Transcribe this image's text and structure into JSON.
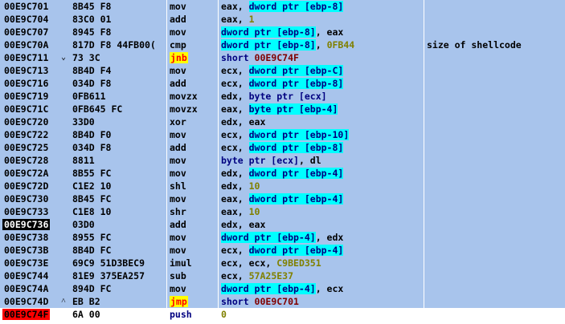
{
  "rows": [
    {
      "addr": "00E9C701",
      "arrow": "",
      "hex": "8B45 F8",
      "mnem": "mov",
      "mnem_style": "plain",
      "ops": [
        {
          "t": "eax, ",
          "k": "reg"
        },
        {
          "t": "dword ptr [ebp-8]",
          "k": "mem"
        }
      ],
      "comment": ""
    },
    {
      "addr": "00E9C704",
      "arrow": "",
      "hex": "83C0 01",
      "mnem": "add",
      "mnem_style": "plain",
      "ops": [
        {
          "t": "eax, ",
          "k": "reg"
        },
        {
          "t": "1",
          "k": "num"
        }
      ],
      "comment": ""
    },
    {
      "addr": "00E9C707",
      "arrow": "",
      "hex": "8945 F8",
      "mnem": "mov",
      "mnem_style": "plain",
      "ops": [
        {
          "t": "dword ptr [ebp-8]",
          "k": "mem"
        },
        {
          "t": ", eax",
          "k": "reg"
        }
      ],
      "comment": ""
    },
    {
      "addr": "00E9C70A",
      "arrow": "",
      "hex": "817D F8 44FB00(",
      "mnem": "cmp",
      "mnem_style": "plain",
      "ops": [
        {
          "t": "dword ptr [ebp-8]",
          "k": "mem"
        },
        {
          "t": ", ",
          "k": "reg"
        },
        {
          "t": "0FB44",
          "k": "num"
        }
      ],
      "comment": "size of shellcode"
    },
    {
      "addr": "00E9C711",
      "arrow": "v",
      "hex": "73 3C",
      "mnem": "jnb",
      "mnem_style": "jmp",
      "ops": [
        {
          "t": "short ",
          "k": "kw"
        },
        {
          "t": "00E9C74F",
          "k": "tgt"
        }
      ],
      "comment": ""
    },
    {
      "addr": "00E9C713",
      "arrow": "",
      "hex": "8B4D F4",
      "mnem": "mov",
      "mnem_style": "plain",
      "ops": [
        {
          "t": "ecx, ",
          "k": "reg"
        },
        {
          "t": "dword ptr [ebp-C]",
          "k": "mem"
        }
      ],
      "comment": ""
    },
    {
      "addr": "00E9C716",
      "arrow": "",
      "hex": "034D F8",
      "mnem": "add",
      "mnem_style": "plain",
      "ops": [
        {
          "t": "ecx, ",
          "k": "reg"
        },
        {
          "t": "dword ptr [ebp-8]",
          "k": "mem"
        }
      ],
      "comment": ""
    },
    {
      "addr": "00E9C719",
      "arrow": "",
      "hex": "0FB611",
      "mnem": "movzx",
      "mnem_style": "plain",
      "ops": [
        {
          "t": "edx, ",
          "k": "reg"
        },
        {
          "t": "byte ptr [ecx]",
          "k": "kw"
        }
      ],
      "comment": ""
    },
    {
      "addr": "00E9C71C",
      "arrow": "",
      "hex": "0FB645 FC",
      "mnem": "movzx",
      "mnem_style": "plain",
      "ops": [
        {
          "t": "eax, ",
          "k": "reg"
        },
        {
          "t": "byte ptr [ebp-4]",
          "k": "mem"
        }
      ],
      "comment": ""
    },
    {
      "addr": "00E9C720",
      "arrow": "",
      "hex": "33D0",
      "mnem": "xor",
      "mnem_style": "plain",
      "ops": [
        {
          "t": "edx, eax",
          "k": "reg"
        }
      ],
      "comment": ""
    },
    {
      "addr": "00E9C722",
      "arrow": "",
      "hex": "8B4D F0",
      "mnem": "mov",
      "mnem_style": "plain",
      "ops": [
        {
          "t": "ecx, ",
          "k": "reg"
        },
        {
          "t": "dword ptr [ebp-10]",
          "k": "mem"
        }
      ],
      "comment": ""
    },
    {
      "addr": "00E9C725",
      "arrow": "",
      "hex": "034D F8",
      "mnem": "add",
      "mnem_style": "plain",
      "ops": [
        {
          "t": "ecx, ",
          "k": "reg"
        },
        {
          "t": "dword ptr [ebp-8]",
          "k": "mem"
        }
      ],
      "comment": ""
    },
    {
      "addr": "00E9C728",
      "arrow": "",
      "hex": "8811",
      "mnem": "mov",
      "mnem_style": "plain",
      "ops": [
        {
          "t": "byte ptr [ecx]",
          "k": "kw"
        },
        {
          "t": ", dl",
          "k": "reg"
        }
      ],
      "comment": ""
    },
    {
      "addr": "00E9C72A",
      "arrow": "",
      "hex": "8B55 FC",
      "mnem": "mov",
      "mnem_style": "plain",
      "ops": [
        {
          "t": "edx, ",
          "k": "reg"
        },
        {
          "t": "dword ptr [ebp-4]",
          "k": "mem"
        }
      ],
      "comment": ""
    },
    {
      "addr": "00E9C72D",
      "arrow": "",
      "hex": "C1E2 10",
      "mnem": "shl",
      "mnem_style": "plain",
      "ops": [
        {
          "t": "edx, ",
          "k": "reg"
        },
        {
          "t": "10",
          "k": "num"
        }
      ],
      "comment": ""
    },
    {
      "addr": "00E9C730",
      "arrow": "",
      "hex": "8B45 FC",
      "mnem": "mov",
      "mnem_style": "plain",
      "ops": [
        {
          "t": "eax, ",
          "k": "reg"
        },
        {
          "t": "dword ptr [ebp-4]",
          "k": "mem"
        }
      ],
      "comment": ""
    },
    {
      "addr": "00E9C733",
      "arrow": "",
      "hex": "C1E8 10",
      "mnem": "shr",
      "mnem_style": "plain",
      "ops": [
        {
          "t": "eax, ",
          "k": "reg"
        },
        {
          "t": "10",
          "k": "num"
        }
      ],
      "comment": ""
    },
    {
      "addr": "00E9C736",
      "addr_style": "cur",
      "arrow": "",
      "hex": "03D0",
      "mnem": "add",
      "mnem_style": "plain",
      "ops": [
        {
          "t": "edx, eax",
          "k": "reg"
        }
      ],
      "comment": ""
    },
    {
      "addr": "00E9C738",
      "arrow": "",
      "hex": "8955 FC",
      "mnem": "mov",
      "mnem_style": "plain",
      "ops": [
        {
          "t": "dword ptr [ebp-4]",
          "k": "mem"
        },
        {
          "t": ", edx",
          "k": "reg"
        }
      ],
      "comment": ""
    },
    {
      "addr": "00E9C73B",
      "arrow": "",
      "hex": "8B4D FC",
      "mnem": "mov",
      "mnem_style": "plain",
      "ops": [
        {
          "t": "ecx, ",
          "k": "reg"
        },
        {
          "t": "dword ptr [ebp-4]",
          "k": "mem"
        }
      ],
      "comment": ""
    },
    {
      "addr": "00E9C73E",
      "arrow": "",
      "hex": "69C9 51D3BEC9",
      "mnem": "imul",
      "mnem_style": "plain",
      "ops": [
        {
          "t": "ecx, ecx, ",
          "k": "reg"
        },
        {
          "t": "C9BED351",
          "k": "num"
        }
      ],
      "comment": ""
    },
    {
      "addr": "00E9C744",
      "arrow": "",
      "hex": "81E9 375EA257",
      "mnem": "sub",
      "mnem_style": "plain",
      "ops": [
        {
          "t": "ecx, ",
          "k": "reg"
        },
        {
          "t": "57A25E37",
          "k": "num"
        }
      ],
      "comment": ""
    },
    {
      "addr": "00E9C74A",
      "arrow": "",
      "hex": "894D FC",
      "mnem": "mov",
      "mnem_style": "plain",
      "ops": [
        {
          "t": "dword ptr [ebp-4]",
          "k": "mem"
        },
        {
          "t": ", ecx",
          "k": "reg"
        }
      ],
      "comment": ""
    },
    {
      "addr": "00E9C74D",
      "arrow": "^",
      "hex": "EB B2",
      "mnem": "jmp",
      "mnem_style": "jmp",
      "ops": [
        {
          "t": "short ",
          "k": "kw"
        },
        {
          "t": "00E9C701",
          "k": "tgt"
        }
      ],
      "comment": ""
    },
    {
      "addr": "00E9C74F",
      "addr_style": "bp",
      "arrow": "",
      "hex": "6A 00",
      "mnem": "push",
      "mnem_style": "kwblue",
      "ops": [
        {
          "t": "0",
          "k": "num"
        }
      ],
      "comment": "",
      "last": true
    }
  ]
}
